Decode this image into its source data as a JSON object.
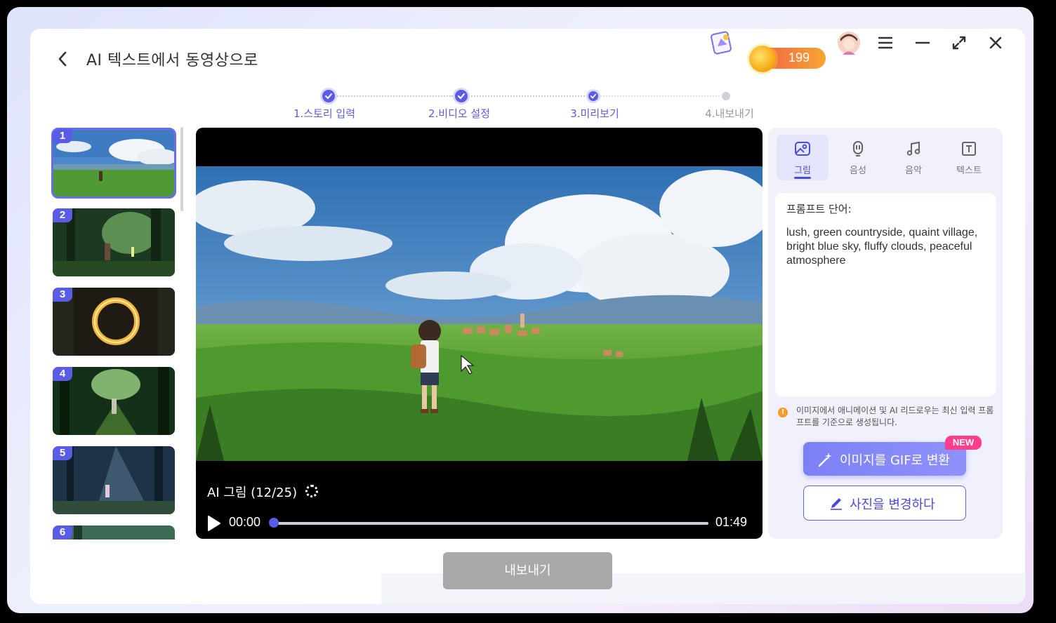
{
  "header": {
    "title": "AI 텍스트에서 동영상으로",
    "coins": "199"
  },
  "steps": [
    {
      "label": "1.스토리 입력",
      "state": "done"
    },
    {
      "label": "2.비디오 설정",
      "state": "done"
    },
    {
      "label": "3.미리보기",
      "state": "current"
    },
    {
      "label": "4.내보내기",
      "state": "todo"
    }
  ],
  "thumbnails": [
    "1",
    "2",
    "3",
    "4",
    "5",
    "6"
  ],
  "player": {
    "status": "AI 그림 (12/25)",
    "current_time": "00:00",
    "total_time": "01:49",
    "progress": 0
  },
  "side": {
    "tabs": [
      "그림",
      "음성",
      "음악",
      "텍스트"
    ],
    "active_tab": "그림",
    "prompt_label": "프롬프트 단어:",
    "prompt_text": "lush, green countryside, quaint village, bright blue sky, fluffy clouds, peaceful atmosphere",
    "notice": "이미지에서 애니메이션 및 AI 리드로우는 최신 입력 프롬프트를 기준으로 생성됩니다.",
    "gif_button": "이미지를 GIF로 변환",
    "new_badge": "NEW",
    "change_button": "사진을 변경하다"
  },
  "export_button": "내보내기",
  "colors": {
    "accent": "#5b5ce5",
    "export_disabled": "#a9a9a9",
    "new_badge": "#ff3d8e"
  }
}
